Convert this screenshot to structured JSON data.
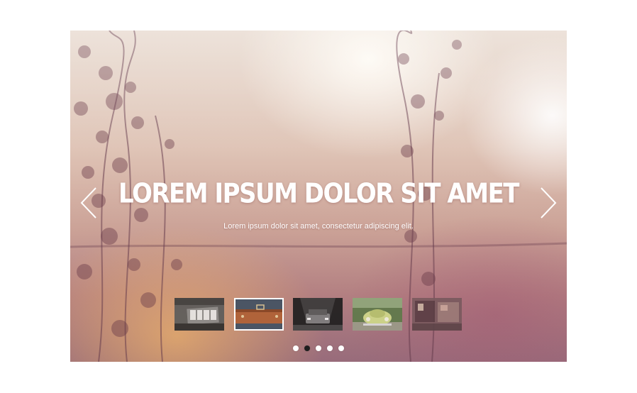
{
  "slide": {
    "title": "LOREM IPSUM DOLOR SIT AMET",
    "subtitle": "Lorem ipsum dolor sit amet, consectetur adipiscing elit."
  },
  "navigation": {
    "prev_icon": "chevron-left-icon",
    "next_icon": "chevron-right-icon"
  },
  "thumbnails": [
    {
      "name": "thumb-blood-sign",
      "active": false
    },
    {
      "name": "thumb-briefcase",
      "active": true
    },
    {
      "name": "thumb-car-garage",
      "active": false
    },
    {
      "name": "thumb-beetle",
      "active": false
    },
    {
      "name": "thumb-storefront",
      "active": false
    }
  ],
  "pagination": {
    "count": 5,
    "active_index": 1
  },
  "colors": {
    "accent_dot_active": "#1e1e1e",
    "dot_inactive": "#ffffff",
    "text": "#ffffff"
  }
}
